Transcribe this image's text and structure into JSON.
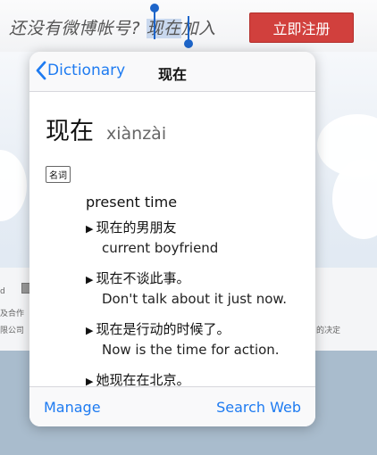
{
  "page": {
    "prompt_before": "还没有微博帐号?",
    "selected_word": "现在",
    "prompt_after": "加入",
    "register_label": "立即注册",
    "bg_snippets": [
      "d",
      "及合作",
      "限公司",
      "的决定"
    ]
  },
  "popover": {
    "back_label": "Dictionary",
    "title": "现在",
    "headword": "现在",
    "pinyin": "xiànzài",
    "pos": "名词",
    "sense": "present time",
    "examples": [
      {
        "zh": "现在的男朋友",
        "en": "current boyfriend"
      },
      {
        "zh": "现在不谈此事。",
        "en": "Don't talk about it just now."
      },
      {
        "zh": "现在是行动的时候了。",
        "en": "Now is the time for action."
      },
      {
        "zh": "她现在在北京。",
        "en": ""
      }
    ],
    "manage_label": "Manage",
    "search_web_label": "Search Web"
  },
  "colors": {
    "accent": "#1e7bf1",
    "register": "#d1403d"
  },
  "icons": {
    "back": "chevron-left-icon"
  }
}
